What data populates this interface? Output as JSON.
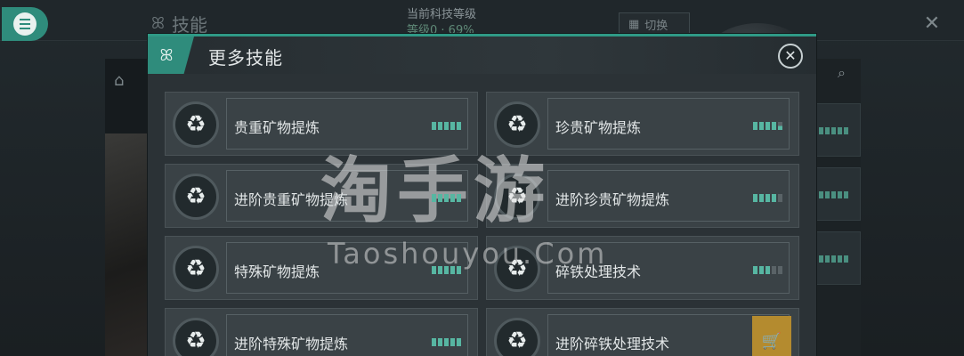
{
  "background": {
    "title": "技能",
    "level_label": "当前科技等级",
    "level_value": "等级0 · 69%",
    "switch_label": "切换"
  },
  "modal": {
    "title": "更多技能",
    "close_glyph": "✕",
    "skills": [
      {
        "name": "贵重矿物提炼",
        "level": 5,
        "max": 5
      },
      {
        "name": "珍贵矿物提炼",
        "level": 4.5,
        "max": 5
      },
      {
        "name": "进阶贵重矿物提炼",
        "level": 5,
        "max": 5
      },
      {
        "name": "进阶珍贵矿物提炼",
        "level": 4,
        "max": 5
      },
      {
        "name": "特殊矿物提炼",
        "level": 5,
        "max": 5
      },
      {
        "name": "碎铁处理技术",
        "level": 3,
        "max": 5
      },
      {
        "name": "进阶特殊矿物提炼",
        "level": 5,
        "max": 5
      },
      {
        "name": "进阶碎铁处理技术",
        "level": 0,
        "max": 5,
        "purchase": true
      }
    ]
  },
  "watermark": {
    "main": "淘手游",
    "sub": "Taoshouyou.Com"
  },
  "colors": {
    "accent": "#2f8c7c",
    "bar_on": "#57b6a2",
    "cart": "#b48b2f"
  }
}
